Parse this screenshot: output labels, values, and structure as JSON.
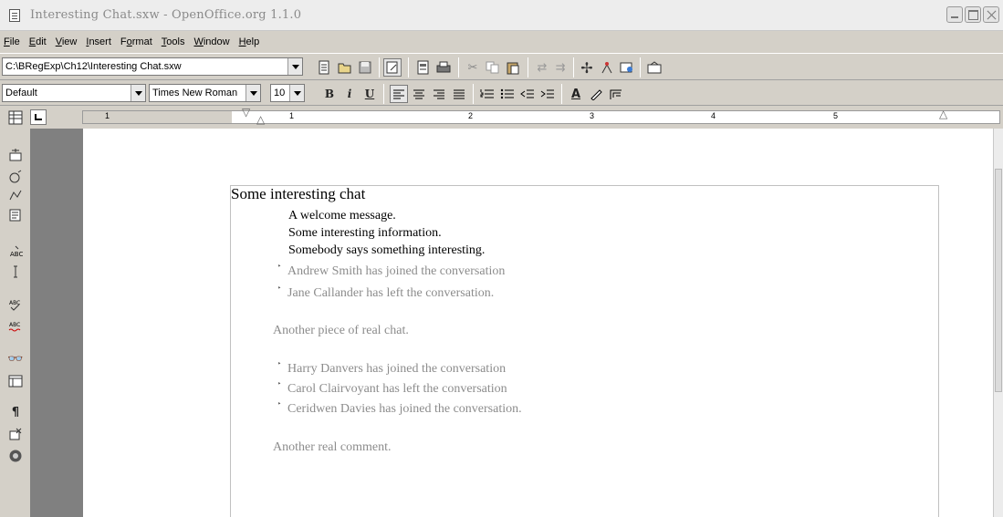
{
  "window": {
    "title": "Interesting Chat.sxw - OpenOffice.org 1.1.0"
  },
  "menu": [
    {
      "label": "File",
      "u": "F",
      "rest": "ile"
    },
    {
      "label": "Edit",
      "u": "E",
      "rest": "dit"
    },
    {
      "label": "View",
      "u": "V",
      "rest": "iew"
    },
    {
      "label": "Insert",
      "u": "I",
      "rest": "nsert"
    },
    {
      "label": "Format",
      "pre": "F",
      "u": "o",
      "rest": "rmat"
    },
    {
      "label": "Tools",
      "u": "T",
      "rest": "ools"
    },
    {
      "label": "Window",
      "u": "W",
      "rest": "indow"
    },
    {
      "label": "Help",
      "u": "H",
      "rest": "elp"
    }
  ],
  "function_bar": {
    "url": "C:\\BRegExp\\Ch12\\Interesting Chat.sxw",
    "icons": [
      "new-document-icon",
      "open-icon",
      "save-icon",
      "edit-file-icon",
      "export-pdf-icon",
      "print-icon",
      "cut-icon",
      "copy-icon",
      "paste-icon",
      "undo-icon",
      "redo-icon",
      "navigator-icon",
      "stylist-icon",
      "gallery-icon",
      "data-sources-icon"
    ]
  },
  "object_bar": {
    "paragraph_style": "Default",
    "font_name": "Times New Roman",
    "font_size": "10",
    "bold_label": "B",
    "italic_label": "i",
    "underline_label": "U",
    "font_color_label": "A"
  },
  "ruler": {
    "numbers": [
      "1",
      "1",
      "2",
      "3",
      "4",
      "5"
    ]
  },
  "document": {
    "heading": "Some interesting chat",
    "lines_black": [
      "A welcome message.",
      "Some interesting information.",
      "Somebody says something interesting."
    ],
    "bulleted_group_1": [
      "Andrew Smith has joined the conversation",
      "Jane Callander has left the conversation."
    ],
    "chat_1": "Another piece of real chat.",
    "bulleted_group_2": [
      "Harry Danvers has joined the conversation",
      "Carol Clairvoyant has left the conversation",
      "Ceridwen Davies has joined the conversation."
    ],
    "chat_2": "Another real comment.",
    "bullet_glyph": "‣"
  }
}
